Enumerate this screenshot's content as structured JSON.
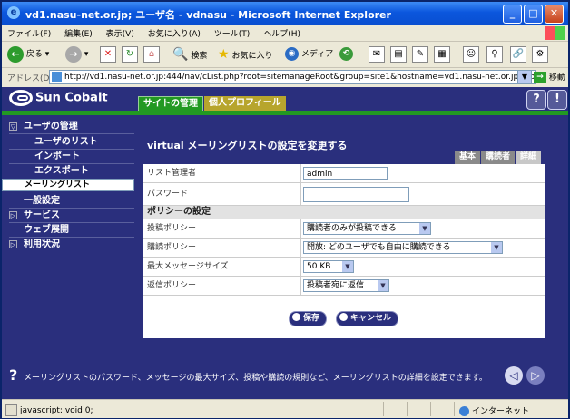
{
  "window": {
    "title": "vd1.nasu-net.or.jp; ユーザ名 - vdnasu - Microsoft Internet Explorer",
    "minimize": "_",
    "maximize": "□",
    "close": "✕"
  },
  "menu": [
    "ファイル(F)",
    "編集(E)",
    "表示(V)",
    "お気に入り(A)",
    "ツール(T)",
    "ヘルプ(H)"
  ],
  "toolbar": {
    "back": "戻る",
    "search": "検索",
    "favorites": "お気に入り",
    "media": "メディア"
  },
  "address": {
    "label": "アドレス(D)",
    "url": "http://vd1.nasu-net.or.jp:444/nav/cList.php?root=sitemanageRoot&group=site1&hostname=vd1.nasu-net.or.jp&goto=base_",
    "go": "移動"
  },
  "banner": {
    "logo": "Sun Cobalt",
    "tabs": [
      "サイトの管理",
      "個人プロフィール"
    ],
    "help": "?",
    "info": "!"
  },
  "sidebar": {
    "items": [
      {
        "label": "ユーザの管理",
        "kind": "top",
        "expanded": true
      },
      {
        "label": "ユーザのリスト",
        "kind": "sub"
      },
      {
        "label": "インポート",
        "kind": "sub"
      },
      {
        "label": "エクスポート",
        "kind": "sub"
      },
      {
        "label": "メーリングリスト",
        "kind": "sub",
        "selected": true
      },
      {
        "label": "一般設定",
        "kind": "plain"
      },
      {
        "label": "サービス",
        "kind": "top",
        "expanded": false
      },
      {
        "label": "ウェブ展開",
        "kind": "plain"
      },
      {
        "label": "利用状況",
        "kind": "top",
        "expanded": false
      }
    ]
  },
  "panel": {
    "title": "virtual メーリングリストの設定を変更する",
    "tabs": [
      {
        "label": "基本",
        "active": false
      },
      {
        "label": "購読者",
        "active": false
      },
      {
        "label": "詳細",
        "active": true
      }
    ],
    "fields": {
      "manager_label": "リスト管理者",
      "manager_value": "admin",
      "password_label": "パスワード",
      "password_value": "",
      "policy_section": "ポリシーの設定",
      "post_label": "投稿ポリシー",
      "post_value": "購読者のみが投稿できる",
      "subscribe_label": "購読ポリシー",
      "subscribe_value": "開放: どのユーザでも自由に購読できる",
      "maxsize_label": "最大メッセージサイズ",
      "maxsize_value": "50 KB",
      "reply_label": "返信ポリシー",
      "reply_value": "投稿者宛に返信"
    },
    "save": "保存",
    "cancel": "キャンセル"
  },
  "helpbar": {
    "text": "メーリングリストのパスワード、メッセージの最大サイズ、投稿や購読の規則など、メーリングリストの詳細を設定できます。"
  },
  "status": {
    "left": "javascript: void 0;",
    "zone": "インターネット"
  },
  "colors": {
    "cobalt_navy": "#2a2f7d",
    "active_tab_green": "#229922",
    "inactive_tab_olive": "#b7a52d"
  }
}
